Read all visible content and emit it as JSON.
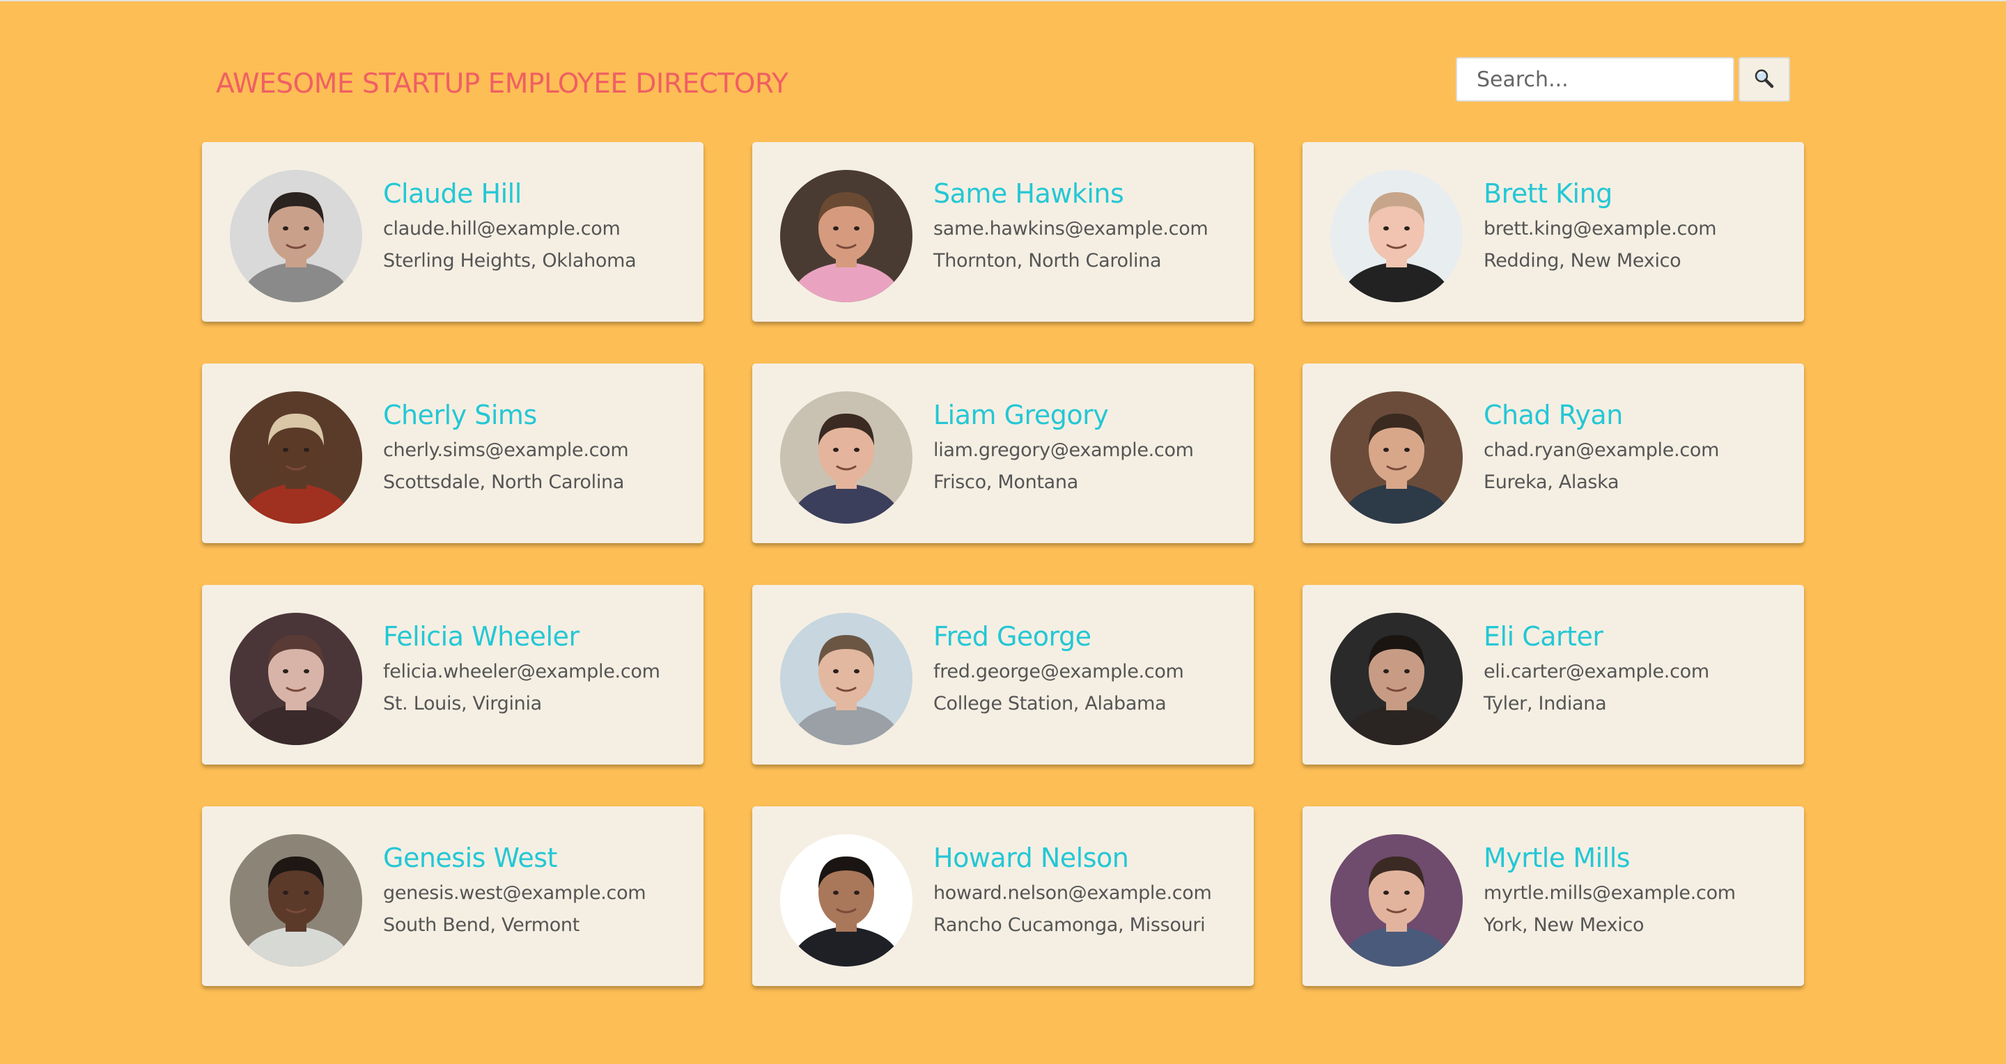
{
  "header": {
    "title": "AWESOME STARTUP EMPLOYEE DIRECTORY"
  },
  "search": {
    "placeholder": "Search...",
    "button_icon": "magnifier-icon"
  },
  "employees": [
    {
      "name": "Claude Hill",
      "email": "claude.hill@example.com",
      "location": "Sterling Heights, Oklahoma",
      "bg": "#d9d9d9",
      "skin": "#c9a08a",
      "hair": "#2b2320",
      "shirt": "#8a8a8a"
    },
    {
      "name": "Same Hawkins",
      "email": "same.hawkins@example.com",
      "location": "Thornton, North Carolina",
      "bg": "#4a3b32",
      "skin": "#d69b7e",
      "hair": "#6b4a33",
      "shirt": "#e9a3c0"
    },
    {
      "name": "Brett King",
      "email": "brett.king@example.com",
      "location": "Redding, New Mexico",
      "bg": "#e8edf0",
      "skin": "#f0c4b0",
      "hair": "#c7a58a",
      "shirt": "#222222"
    },
    {
      "name": "Cherly Sims",
      "email": "cherly.sims@example.com",
      "location": "Scottsdale, North Carolina",
      "bg": "#5a3b2a",
      "skin": "#5c3a28",
      "hair": "#d9c7a8",
      "shirt": "#a0301f"
    },
    {
      "name": "Liam Gregory",
      "email": "liam.gregory@example.com",
      "location": "Frisco, Montana",
      "bg": "#c9c2b3",
      "skin": "#e4b49c",
      "hair": "#3a2a22",
      "shirt": "#3b3f5c"
    },
    {
      "name": "Chad Ryan",
      "email": "chad.ryan@example.com",
      "location": "Eureka, Alaska",
      "bg": "#6b4c3a",
      "skin": "#d8a78a",
      "hair": "#3a2a1f",
      "shirt": "#2d3a48"
    },
    {
      "name": "Felicia Wheeler",
      "email": "felicia.wheeler@example.com",
      "location": "St. Louis, Virginia",
      "bg": "#4a3638",
      "skin": "#d8b4a8",
      "hair": "#5a3a35",
      "shirt": "#3a2a2c"
    },
    {
      "name": "Fred George",
      "email": "fred.george@example.com",
      "location": "College Station, Alabama",
      "bg": "#c7d6df",
      "skin": "#e2b8a0",
      "hair": "#6b5644",
      "shirt": "#9aa0a6"
    },
    {
      "name": "Eli Carter",
      "email": "eli.carter@example.com",
      "location": "Tyler, Indiana",
      "bg": "#2a2a2a",
      "skin": "#c89c84",
      "hair": "#1b1512",
      "shirt": "#2a2522"
    },
    {
      "name": "Genesis West",
      "email": "genesis.west@example.com",
      "location": "South Bend, Vermont",
      "bg": "#8d8478",
      "skin": "#5b3a2a",
      "hair": "#1e1714",
      "shirt": "#d7d9d4"
    },
    {
      "name": "Howard Nelson",
      "email": "howard.nelson@example.com",
      "location": "Rancho Cucamonga, Missouri",
      "bg": "#ffffff",
      "skin": "#a9775a",
      "hair": "#1a1512",
      "shirt": "#1f2026"
    },
    {
      "name": "Myrtle Mills",
      "email": "myrtle.mills@example.com",
      "location": "York, New Mexico",
      "bg": "#6f4b6e",
      "skin": "#e2b49e",
      "hair": "#3b2a24",
      "shirt": "#4a5a7a"
    }
  ]
}
